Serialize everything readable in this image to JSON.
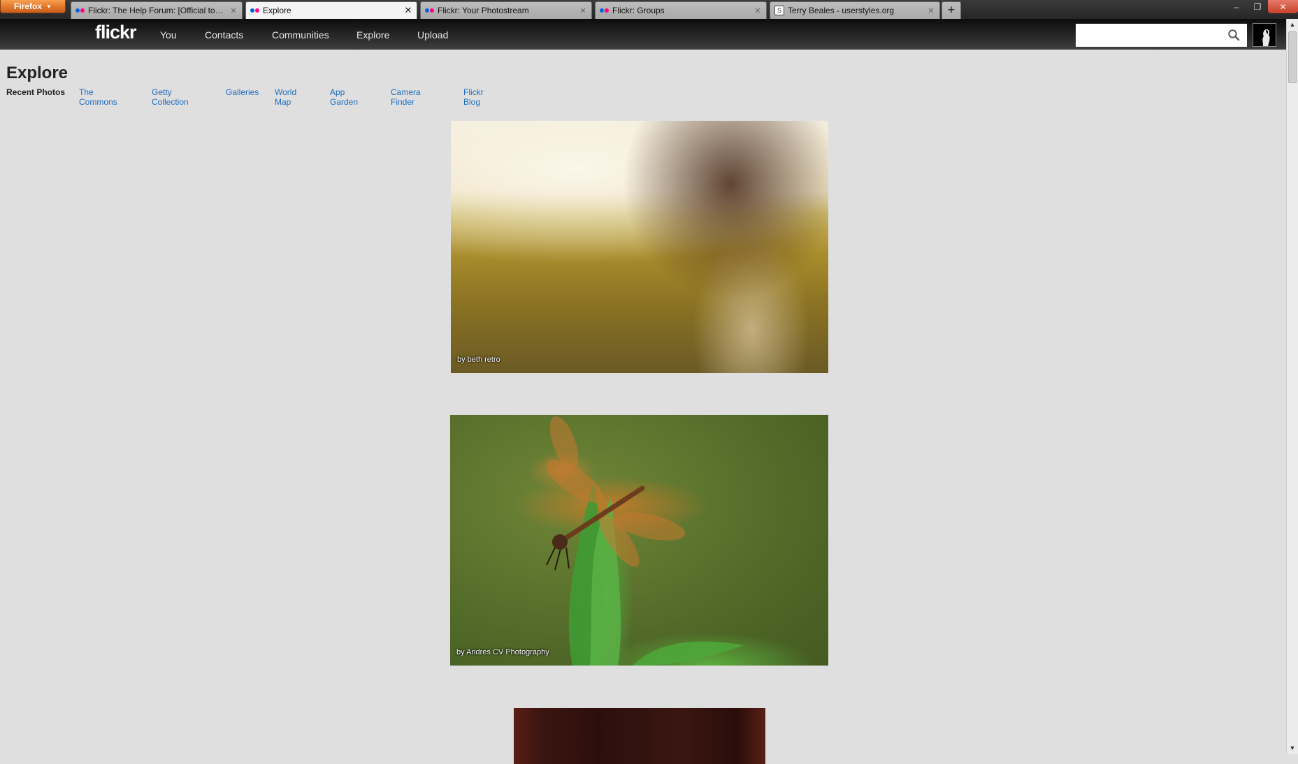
{
  "browser": {
    "app_button": "Firefox",
    "tabs": [
      {
        "title": "Flickr: The Help Forum: [Official topic...",
        "icon": "flickr-dots-icon"
      },
      {
        "title": "Explore",
        "icon": "flickr-dots-icon",
        "active": true
      },
      {
        "title": "Flickr: Your Photostream",
        "icon": "flickr-dots-icon"
      },
      {
        "title": "Flickr: Groups",
        "icon": "flickr-dots-icon"
      },
      {
        "title": "Terry Beales - userstyles.org",
        "icon": "userstyles-icon"
      }
    ],
    "new_tab_glyph": "+",
    "window_controls": {
      "minimize": "‒",
      "maximize": "❐",
      "close": "✕"
    }
  },
  "header": {
    "logo": "flickr",
    "nav": [
      "You",
      "Contacts",
      "Communities",
      "Explore",
      "Upload"
    ],
    "search": {
      "value": "",
      "placeholder": ""
    }
  },
  "explore": {
    "title": "Explore",
    "subnav_current": "Recent Photos",
    "subnav_links": [
      "The Commons",
      "Getty Collection",
      "Galleries",
      "World Map",
      "App Garden",
      "Camera Finder",
      "Flickr Blog"
    ]
  },
  "photos": [
    {
      "credit": "by beth retro"
    },
    {
      "credit": "by Andres CV Photography"
    },
    {
      "credit": ""
    }
  ],
  "colors": {
    "page_background": "#dfdfdf",
    "link": "#1f6ec0",
    "flickr_blue": "#0063dc",
    "flickr_pink": "#ff0084"
  }
}
